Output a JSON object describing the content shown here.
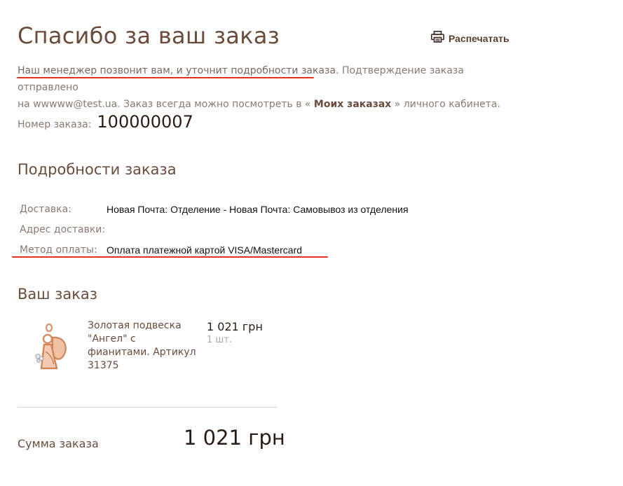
{
  "header": {
    "title": "Спасибо за ваш заказ",
    "print_label": "Распечатать"
  },
  "intro": {
    "line1_highlight": "Наш менеджер позвонит вам, и уточнит подробности заказа",
    "line1_rest": ". Подтверждение заказа отправлено",
    "line2_prefix": "на wwwww@test.ua. Заказ всегда можно посмотреть в «",
    "my_orders_link": "Моих заказах",
    "line2_suffix": "» личного кабинета."
  },
  "order": {
    "number_label": "Номер заказа:",
    "number_value": "100000007"
  },
  "details": {
    "heading": "Подробности заказа",
    "rows": [
      {
        "label": "Доставка:",
        "value": "Новая Почта: Отделение - Новая Почта: Самовывоз из отделения"
      },
      {
        "label": "Адрес доставки:",
        "value": ""
      },
      {
        "label": "Метод оплаты:",
        "value": "Оплата платежной картой VISA/Mastercard"
      }
    ]
  },
  "cart": {
    "heading": "Ваш заказ",
    "items": [
      {
        "name": "Золотая подвеска \"Ангел\" с фианитами. Артикул 31375",
        "price": "1 021 грн",
        "qty": "1 шт."
      }
    ]
  },
  "total": {
    "label": "Сумма заказа",
    "value": "1 021 грн"
  },
  "colors": {
    "accent_underline": "#e2321e",
    "heading_brown": "#6a4b3c"
  },
  "icons": {
    "print": "printer-icon",
    "product": "angel-pendant-image"
  }
}
